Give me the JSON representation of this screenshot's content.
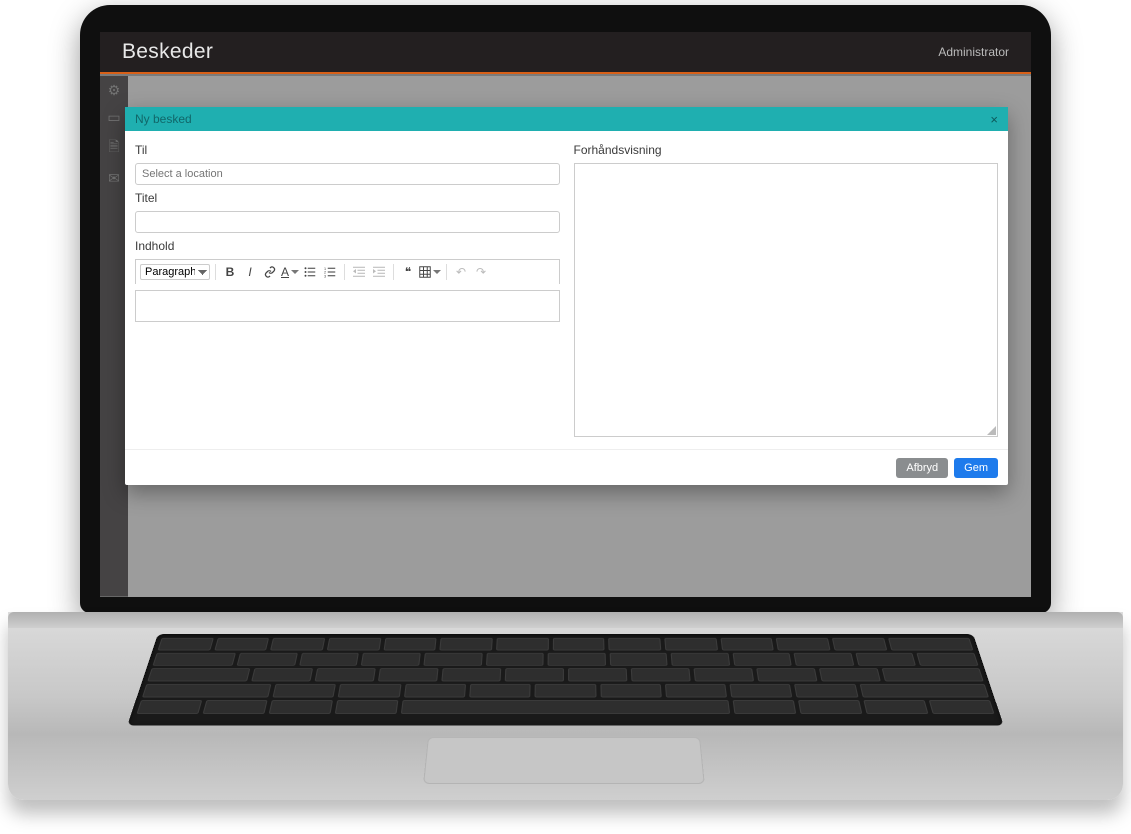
{
  "header": {
    "title": "Beskeder",
    "user": "Administrator"
  },
  "modal": {
    "title": "Ny besked",
    "labels": {
      "to": "Til",
      "to_placeholder": "Select a location",
      "title": "Titel",
      "content": "Indhold",
      "preview": "Forhåndsvisning"
    },
    "toolbar": {
      "paragraph": "Paragraph"
    },
    "footer": {
      "cancel": "Afbryd",
      "save": "Gem"
    }
  }
}
